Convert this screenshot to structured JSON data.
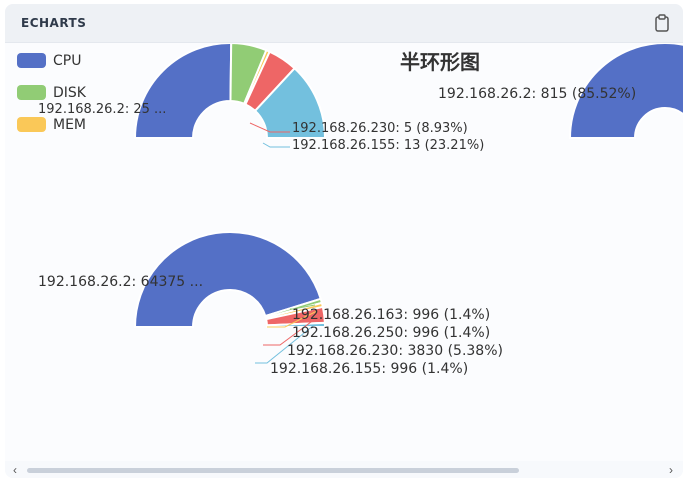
{
  "header": {
    "title": "ECHARTS",
    "clipboard_icon": "clipboard-icon"
  },
  "colors": {
    "blue": "#5470c6",
    "green": "#91cc75",
    "yellow": "#fac858",
    "red": "#ee6666",
    "cyan": "#73c0de",
    "purple": "#9a60b4"
  },
  "legend": [
    {
      "label": "CPU",
      "color": "#5470c6"
    },
    {
      "label": "DISK",
      "color": "#91cc75"
    },
    {
      "label": "MEM",
      "color": "#fac858"
    }
  ],
  "chart_data": [
    {
      "type": "pie",
      "title": "",
      "series": [
        {
          "name": "CPU",
          "slices": [
            {
              "label": "192.168.26.2",
              "value": 25
            },
            {
              "label": "",
              "value": 6
            },
            {
              "label": "",
              "value": 0.6
            },
            {
              "label": "192.168.26.230",
              "value": 5
            },
            {
              "label": "192.168.26.155",
              "value": 13
            }
          ]
        }
      ],
      "labels": [
        "192.168.26.2: 25 ...",
        "192.168.26.230: 5 (8.93%)",
        "192.168.26.155: 13 (23.21%)"
      ]
    },
    {
      "type": "pie",
      "title": "半环形图",
      "series": [
        {
          "name": "DISK",
          "slices": [
            {
              "label": "192.168.26.2",
              "value": 815,
              "percent": 85.52
            }
          ]
        }
      ],
      "labels": [
        "192.168.26.2: 815 (85.52%)"
      ]
    },
    {
      "type": "pie",
      "title": "",
      "series": [
        {
          "name": "MEM",
          "slices": [
            {
              "label": "192.168.26.2",
              "value": 64375
            },
            {
              "label": "192.168.26.163",
              "value": 996,
              "percent": 1.4
            },
            {
              "label": "192.168.26.250",
              "value": 996,
              "percent": 1.4
            },
            {
              "label": "192.168.26.230",
              "value": 3830,
              "percent": 5.38
            },
            {
              "label": "192.168.26.155",
              "value": 996,
              "percent": 1.4
            }
          ]
        }
      ],
      "labels": [
        "192.168.26.2: 64375 ...",
        "192.168.26.163: 996 (1.4%)",
        "192.168.26.250: 996 (1.4%)",
        "192.168.26.230: 3830 (5.38%)",
        "192.168.26.155: 996 (1.4%)"
      ]
    }
  ]
}
